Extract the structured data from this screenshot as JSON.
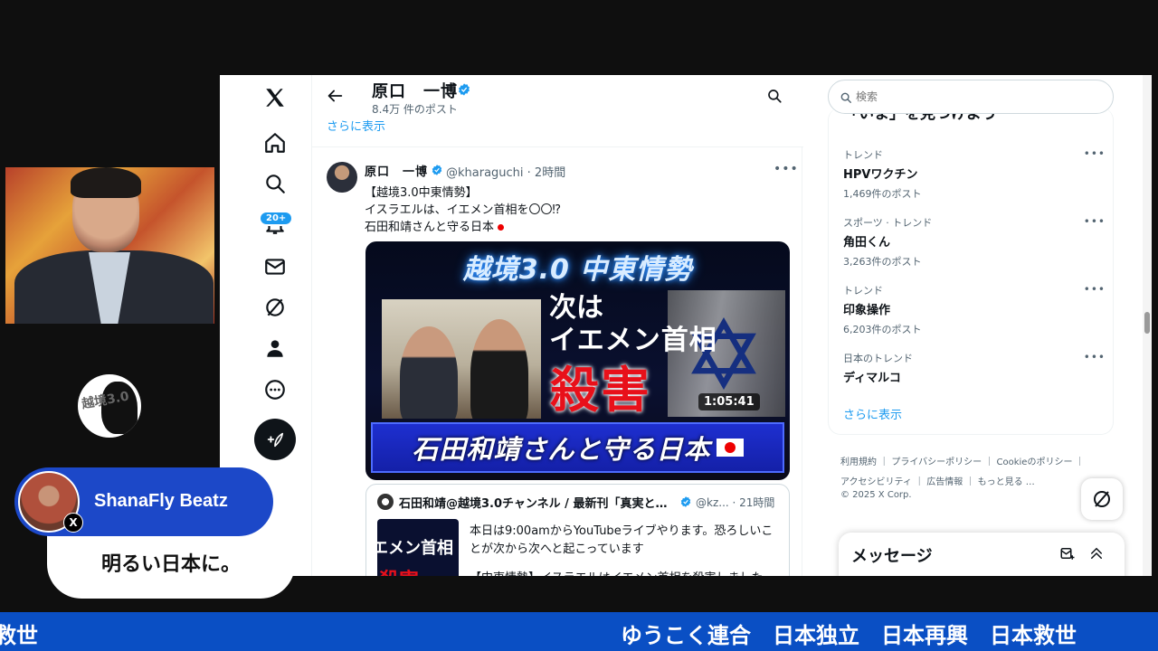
{
  "profile": {
    "name": "原口　一博",
    "post_count": "8.4万 件のポスト",
    "show_more": "さらに表示"
  },
  "nav": {
    "notifications_badge": "20+"
  },
  "tweet": {
    "author_name": "原口　一博",
    "author_handle": "@kharaguchi · 2時間",
    "line1": "【越境3.0中東情勢】",
    "line2": "イスラエルは、イエメン首相を〇〇⁉",
    "line3": "石田和靖さんと守る日本"
  },
  "video": {
    "title": "越境3.0 中東情勢",
    "headline_1": "次は",
    "headline_2": "イエメン首相",
    "headline_3": "殺害",
    "duration": "1:05:41",
    "banner": "石田和靖さんと守る日本"
  },
  "quote": {
    "author_name": "石田和靖@越境3.0チャンネル / 最新刊「真実と…",
    "author_handle": "@kz... · 21時間",
    "thumb_text": "エメン首相",
    "thumb_red": "殺害",
    "line1": "本日は9:00amからYouTubeライブやります。恐ろしいこ",
    "line2": "とが次から次へと起こっています",
    "line3": "【中東情勢】イスラエルはイエメン首相を殺害しました"
  },
  "search": {
    "placeholder": "検索"
  },
  "trends": {
    "title": "「いま」を見つけよう",
    "items": [
      {
        "category": "トレンド",
        "name": "HPVワクチン",
        "count": "1,469件のポスト"
      },
      {
        "category": "スポーツ · トレンド",
        "name": "角田くん",
        "count": "3,263件のポスト"
      },
      {
        "category": "トレンド",
        "name": "印象操作",
        "count": "6,203件のポスト"
      },
      {
        "category": "日本のトレンド",
        "name": "ディマルコ",
        "count": ""
      }
    ],
    "show_more": "さらに表示"
  },
  "footer": {
    "links_line1": "利用規約 ｜ プライバシーポリシー ｜ Cookieのポリシー ｜",
    "links_line2": "アクセシビリティ ｜ 広告情報 ｜ もっと見る …",
    "copyright": "© 2025 X Corp."
  },
  "messages": {
    "title": "メッセージ"
  },
  "overlay": {
    "logo_text": "越境3.0",
    "chat_user": "ShanaFly Beatz",
    "chat_x_badge": "X",
    "chat_message": "明るい日本に。",
    "ticker_left": "救世",
    "ticker_main": "ゆうこく連合　日本独立　日本再興　日本救世"
  },
  "colors": {
    "accent": "#1d9bf0",
    "ticker_bg": "#0a4fc4",
    "chat_bar": "#1c48c8",
    "headline_red": "#e8101a"
  },
  "icons": [
    "x-logo-icon",
    "home-icon",
    "search-icon",
    "bell-icon",
    "mail-icon",
    "grok-icon",
    "profile-icon",
    "more-icon",
    "compose-icon",
    "back-arrow-icon",
    "verified-icon",
    "star-of-david-icon",
    "new-message-icon",
    "chevron-up-icon"
  ]
}
